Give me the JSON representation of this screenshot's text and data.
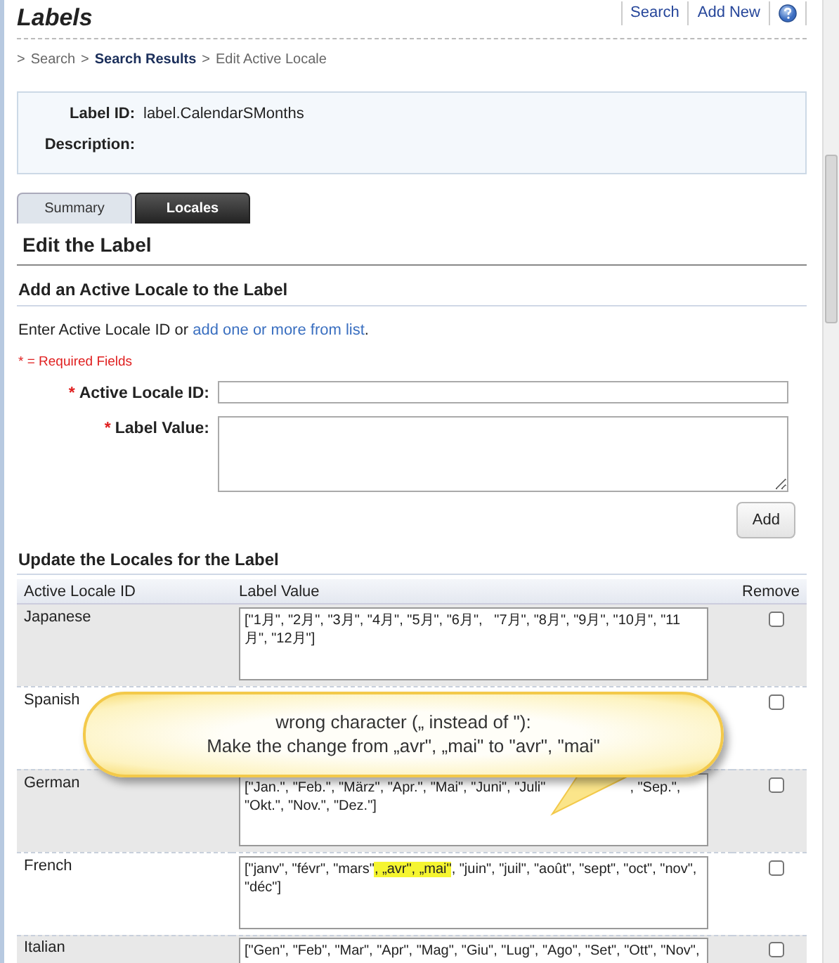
{
  "page_title": "Labels",
  "header_links": [
    "Search",
    "Add New"
  ],
  "breadcrumb": [
    {
      "prefix": ">",
      "label": "Search",
      "bold": false
    },
    {
      "prefix": ">",
      "label": "Search Results",
      "bold": true
    },
    {
      "prefix": ">",
      "label": "Edit Active Locale",
      "bold": false
    }
  ],
  "info": [
    {
      "label": "Label ID:",
      "value": "label.CalendarSMonths"
    },
    {
      "label": "Description:"
    }
  ],
  "tabs": [
    {
      "label": "Summary",
      "selected": false
    },
    {
      "label": "Locales",
      "selected": true
    }
  ],
  "edit_heading": "Edit the Label",
  "add_section": {
    "heading": "Add an Active Locale to the Label",
    "intro": "Enter Active Locale ID or",
    "intro_link": "add one or more from list",
    "intro_end": ".",
    "required_note": "* = Required Fields",
    "fields": [
      {
        "kind": "input",
        "star": "*",
        "label": "Active Locale ID:"
      },
      {
        "kind": "textarea",
        "star": "*",
        "label": "Label Value:"
      }
    ],
    "button": "Add"
  },
  "update_section": {
    "heading": "Update the Locales for the Label",
    "columns": [
      "Active Locale ID",
      "Label Value",
      "Remove"
    ],
    "rows": [
      {
        "locale": "Japanese",
        "value": [
          {
            "kind": "text",
            "text": "[\"1月\", \"2月\", \"3月\", \"4月\", \"5月\", \"6月\",   \"7月\", \"8月\", \"9月\", \"10月\", \"11月\", \"12月\"]",
            "highlighted": false
          }
        ],
        "checked": false
      },
      {
        "locale": "Spanish",
        "checked": false
      },
      {
        "locale": "German",
        "value": [
          {
            "kind": "text",
            "text": "[\"Jan.\", \"Feb.\", \"März\", \"Apr.\", \"Mai\", \"Juni\", \"Juli\"",
            "highlighted": false
          },
          {
            "kind": "covered"
          },
          {
            "kind": "text",
            "text": ", \"Sep.\", \"Okt.\", \"Nov.\", \"Dez.\"]",
            "highlighted": false
          }
        ],
        "checked": false
      },
      {
        "locale": "French",
        "value": [
          {
            "kind": "text",
            "text": "[\"janv\", \"févr\", \"mars\"",
            "highlighted": false
          },
          {
            "kind": "text",
            "text": ", „avr\", „mai\"",
            "highlighted": true
          },
          {
            "kind": "text",
            "text": ", \"juin\", \"juil\", \"août\", \"sept\", \"oct\", \"nov\", \"déc\"]",
            "highlighted": false
          }
        ],
        "checked": false
      },
      {
        "locale": "Italian",
        "value": [
          {
            "kind": "text",
            "text": "[\"Gen\", \"Feb\", \"Mar\", \"Apr\", \"Mag\", \"Giu\", \"Lug\", \"Ago\", \"Set\", \"Ott\", \"Nov\",",
            "highlighted": false
          }
        ],
        "checked": false
      }
    ]
  },
  "callout": {
    "lines": [
      "wrong character („ instead of \"):",
      "Make the change from „avr\", „mai\" to \"avr\", \"mai\""
    ]
  }
}
